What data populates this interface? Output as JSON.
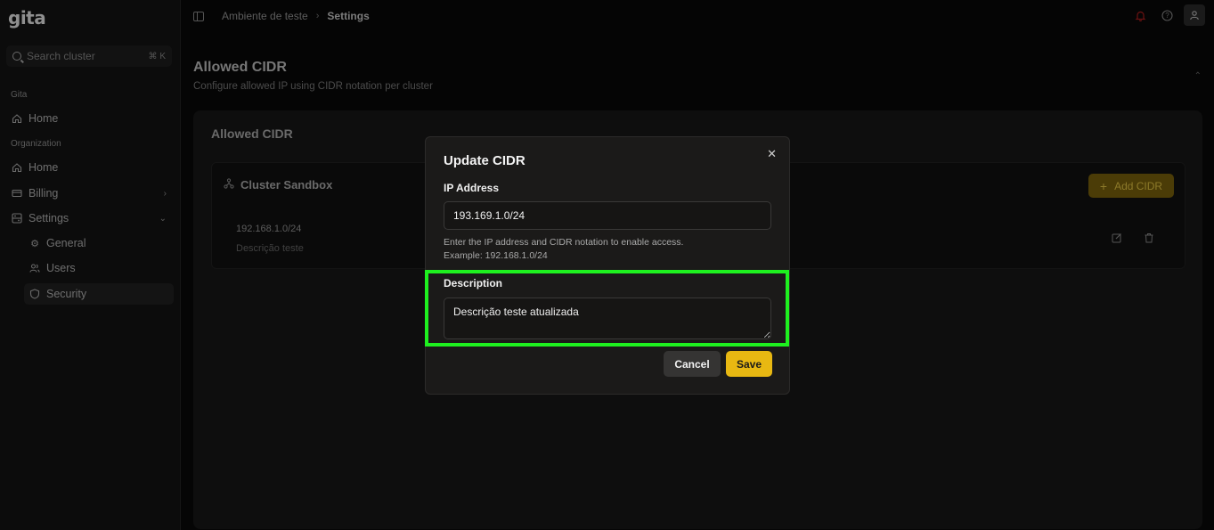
{
  "app": {
    "logo": "gita"
  },
  "sidebar": {
    "search_placeholder": "Search cluster",
    "search_shortcut": "⌘ K",
    "section_gita": "Gita",
    "section_org": "Organization",
    "items": [
      {
        "label": "Home",
        "icon": "home-icon"
      },
      {
        "label": "Home",
        "icon": "home-icon"
      },
      {
        "label": "Billing",
        "icon": "billing-icon"
      },
      {
        "label": "Settings",
        "icon": "settings-icon"
      },
      {
        "label": "General",
        "icon": "gear-icon"
      },
      {
        "label": "Users",
        "icon": "users-icon"
      },
      {
        "label": "Security",
        "icon": "shield-icon"
      }
    ]
  },
  "breadcrumb": {
    "parent": "Ambiente de teste",
    "separator": "›",
    "current": "Settings"
  },
  "page": {
    "title": "Allowed CIDR",
    "subtitle": "Configure allowed IP using CIDR notation per cluster",
    "card_title": "Allowed CIDR",
    "cluster_name": "Cluster Sandbox",
    "add_button": "Add CIDR",
    "row": {
      "ip": "192.168.1.0/24",
      "description": "Descrição teste"
    }
  },
  "modal": {
    "title": "Update CIDR",
    "ip_label": "IP Address",
    "ip_value": "193.169.1.0/24",
    "help_line1": "Enter the IP address and CIDR notation to enable access.",
    "help_line2": "Example: 192.168.1.0/24",
    "desc_label": "Description",
    "desc_value": "Descrição teste atualizada",
    "cancel": "Cancel",
    "save": "Save"
  },
  "colors": {
    "accent": "#e8b812",
    "highlight": "#1ef01f",
    "background": "#050505",
    "modal": "#1b1a19"
  }
}
